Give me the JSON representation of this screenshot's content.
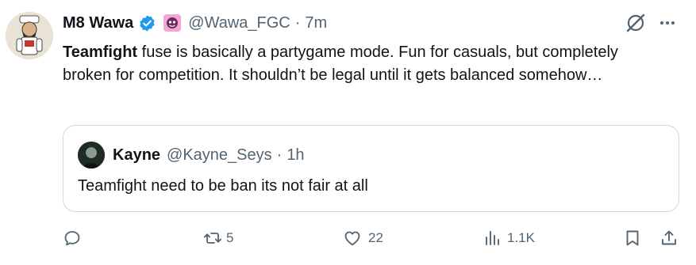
{
  "tweet": {
    "author_name": "M8 Wawa",
    "author_handle": "@Wawa_FGC",
    "separator": "·",
    "time_ago": "7m",
    "text_bold": "Teamfight",
    "text_rest": " fuse is basically a partygame mode. Fun for casuals, but completely broken for competition. It shouldn’t be legal until it gets balanced somehow…"
  },
  "quote": {
    "author_name": "Kayne",
    "author_handle": "@Kayne_Seys",
    "separator": "·",
    "time_ago": "1h",
    "text": "Teamfight need to be ban its not fair at all"
  },
  "actions": {
    "replies": "",
    "retweets": "5",
    "likes": "22",
    "views": "1.1K"
  },
  "colors": {
    "verified_blue": "#1d9bf0",
    "secondary_text": "#536471",
    "border": "#cfd9de",
    "badge_pink": "#f4a7d6"
  },
  "icons": {
    "verified": "verified-badge-icon",
    "badge": "pink-emoji-badge-icon",
    "grok": "grok-icon",
    "more": "more-dots-icon",
    "reply": "reply-icon",
    "retweet": "retweet-icon",
    "like": "heart-icon",
    "views": "views-chart-icon",
    "bookmark": "bookmark-icon",
    "share": "share-icon"
  }
}
